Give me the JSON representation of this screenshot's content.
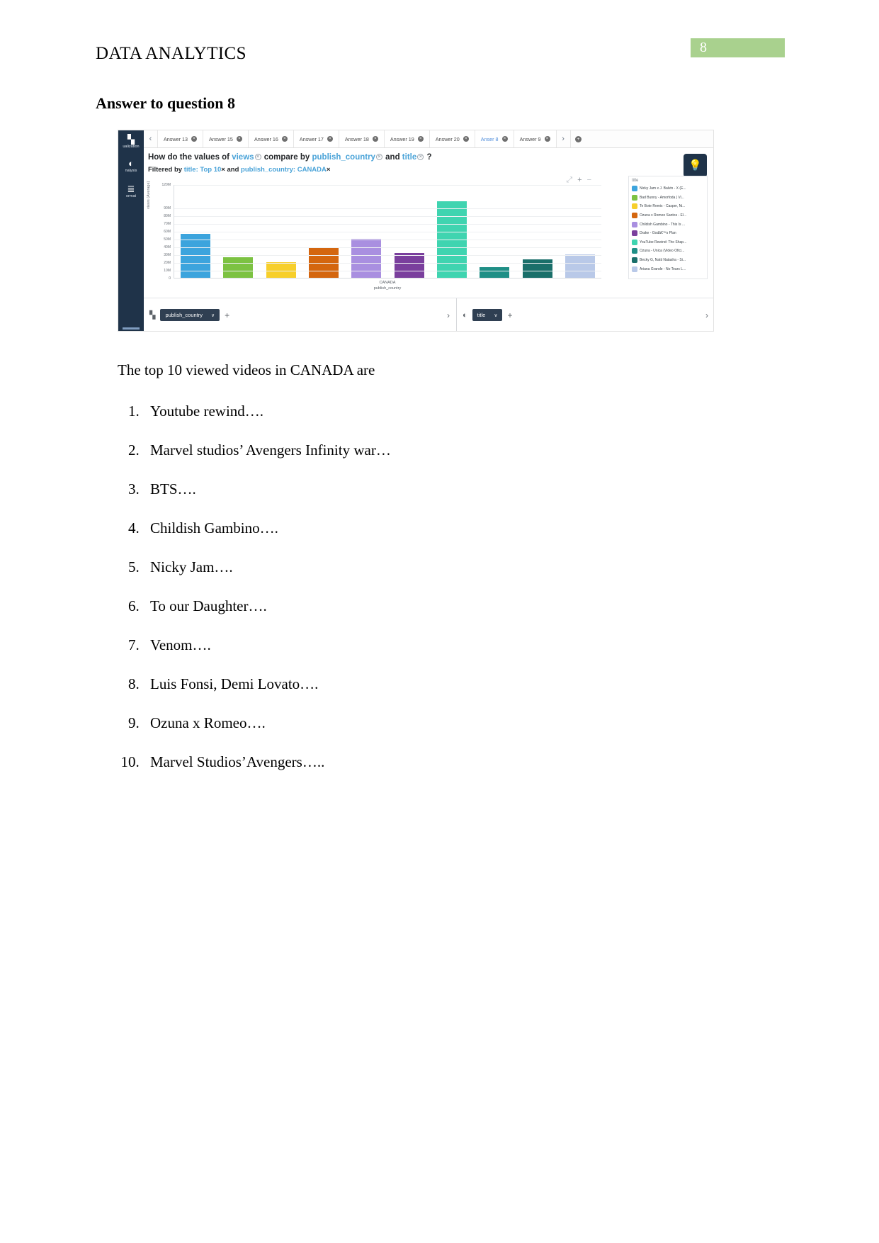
{
  "header": {
    "doc_title": "DATA ANALYTICS",
    "page_number": "8",
    "badge_color": "#a9d18e"
  },
  "heading": "Answer to question 8",
  "screenshot": {
    "rail": [
      {
        "icon": "bar-chart-icon",
        "glyph": "‖",
        "label": "ualization"
      },
      {
        "icon": "analysis-icon",
        "glyph": "◔",
        "label": "nalysis"
      },
      {
        "icon": "format-icon",
        "glyph": "≡",
        "label": "ormat"
      }
    ],
    "tabs": [
      {
        "label": "Answer 13",
        "active": false
      },
      {
        "label": "Answer 15",
        "active": false
      },
      {
        "label": "Answer 16",
        "active": false
      },
      {
        "label": "Answer 17",
        "active": false
      },
      {
        "label": "Answer 18",
        "active": false
      },
      {
        "label": "Answer 19",
        "active": false
      },
      {
        "label": "Answer 20",
        "active": false
      },
      {
        "label": "Anser 8",
        "active": true
      },
      {
        "label": "Answer 9",
        "active": false
      }
    ],
    "tab_close_glyph": "×",
    "tab_prev_glyph": "‹",
    "tab_next_glyph": "›",
    "query": {
      "t1": "How do the values of ",
      "f1": "views",
      "t2": " compare by ",
      "f2": "publish_country",
      "t3": " and ",
      "f3": "title",
      "t4": " ?"
    },
    "filter": {
      "t1": "Filtered by ",
      "f1": "title: Top 10",
      "t2": " and ",
      "f2": "publish_country: CANADA"
    },
    "bulb_icon": "lightbulb-icon",
    "chart_tools": [
      "expand-icon",
      "plus-icon",
      "minus-icon"
    ],
    "shelf_left": {
      "icon": "bar-chart-icon",
      "pill": "publish_country",
      "chevron": "∨",
      "plus": "+",
      "arrow": "›"
    },
    "shelf_right": {
      "icon": "color-icon",
      "pill": "title",
      "chevron": "∨",
      "plus": "+",
      "arrow": "›"
    }
  },
  "chart_data": {
    "type": "bar",
    "title": "",
    "xlabel": "publish_country",
    "ylabel": "views (Average)",
    "x_category": "CANADA",
    "ylim": [
      0,
      120000000
    ],
    "ytick_labels": [
      "120M",
      "90M",
      "80M",
      "70M",
      "60M",
      "50M",
      "40M",
      "30M",
      "20M",
      "10M",
      "0"
    ],
    "ytick_values": [
      120000000,
      90000000,
      80000000,
      70000000,
      60000000,
      50000000,
      40000000,
      30000000,
      20000000,
      10000000,
      0
    ],
    "grid": true,
    "legend_position": "right",
    "legend_title": "title",
    "categories": [
      "Nicky Jam x J. Balvin - X (E...",
      "Bad Bunny - Amorfoda | Vi...",
      "Te Bote Remix - Casper, Ni...",
      "Ozuna x Romeo Santos - El...",
      "Childish Gambino - This Is ...",
      "Drake - Godâ€™s Plan",
      "YouTube Rewind: The Shap...",
      "Ozuna - Única (Video Ofici...",
      "Becky G, Natti Natasha - Si...",
      "Ariana Grande - No Tears L..."
    ],
    "colors": [
      "#3ca4dd",
      "#7cc242",
      "#f7cf2b",
      "#d4660f",
      "#a98fe0",
      "#7a3f9d",
      "#3fd4b0",
      "#1f8f86",
      "#1a6f6a",
      "#b9c9e8"
    ],
    "values": [
      56000000,
      26000000,
      20000000,
      38000000,
      50000000,
      32000000,
      98000000,
      14000000,
      24000000,
      30000000
    ]
  },
  "body": {
    "intro": "The top 10 viewed videos in CANADA are",
    "items": [
      "Youtube rewind….",
      "Marvel studios’ Avengers Infinity war…",
      "BTS….",
      "Childish Gambino….",
      "Nicky Jam….",
      "To our Daughter….",
      "Venom….",
      "Luis Fonsi, Demi Lovato….",
      "Ozuna x Romeo….",
      "Marvel Studios’Avengers….."
    ]
  }
}
